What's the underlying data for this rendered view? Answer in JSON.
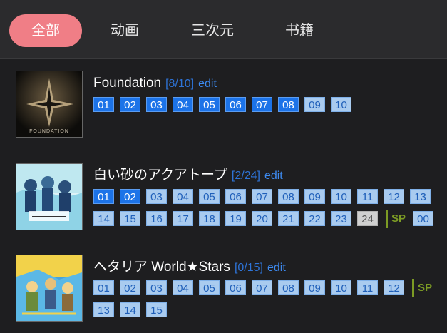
{
  "tabs": [
    "全部",
    "动画",
    "三次元",
    "书籍"
  ],
  "active_tab": 0,
  "items": [
    {
      "title": "Foundation",
      "progress": "[8/10]",
      "edit": "edit",
      "cover_text": "FOUNDATION",
      "episodes": [
        {
          "label": "01",
          "state": "watched"
        },
        {
          "label": "02",
          "state": "watched"
        },
        {
          "label": "03",
          "state": "watched"
        },
        {
          "label": "04",
          "state": "watched"
        },
        {
          "label": "05",
          "state": "watched"
        },
        {
          "label": "06",
          "state": "watched"
        },
        {
          "label": "07",
          "state": "watched"
        },
        {
          "label": "08",
          "state": "watched"
        },
        {
          "label": "09",
          "state": "unwatched"
        },
        {
          "label": "10",
          "state": "unwatched"
        }
      ]
    },
    {
      "title": "白い砂のアクアトープ",
      "progress": "[2/24]",
      "edit": "edit",
      "episodes": [
        {
          "label": "01",
          "state": "watched"
        },
        {
          "label": "02",
          "state": "watched"
        },
        {
          "label": "03",
          "state": "unwatched"
        },
        {
          "label": "04",
          "state": "unwatched"
        },
        {
          "label": "05",
          "state": "unwatched"
        },
        {
          "label": "06",
          "state": "unwatched"
        },
        {
          "label": "07",
          "state": "unwatched"
        },
        {
          "label": "08",
          "state": "unwatched"
        },
        {
          "label": "09",
          "state": "unwatched"
        },
        {
          "label": "10",
          "state": "unwatched"
        },
        {
          "label": "11",
          "state": "unwatched"
        },
        {
          "label": "12",
          "state": "unwatched"
        },
        {
          "label": "13",
          "state": "unwatched"
        },
        {
          "label": "14",
          "state": "unwatched"
        },
        {
          "label": "15",
          "state": "unwatched"
        },
        {
          "label": "16",
          "state": "unwatched"
        },
        {
          "label": "17",
          "state": "unwatched"
        },
        {
          "label": "18",
          "state": "unwatched"
        },
        {
          "label": "19",
          "state": "unwatched"
        },
        {
          "label": "20",
          "state": "unwatched"
        },
        {
          "label": "21",
          "state": "unwatched"
        },
        {
          "label": "22",
          "state": "unwatched"
        },
        {
          "label": "23",
          "state": "unwatched"
        },
        {
          "label": "24",
          "state": "na"
        }
      ],
      "sp_label": "SP",
      "sp_episodes": [
        {
          "label": "00",
          "state": "unwatched"
        }
      ]
    },
    {
      "title": "ヘタリア World★Stars",
      "progress": "[0/15]",
      "edit": "edit",
      "episodes": [
        {
          "label": "01",
          "state": "unwatched"
        },
        {
          "label": "02",
          "state": "unwatched"
        },
        {
          "label": "03",
          "state": "unwatched"
        },
        {
          "label": "04",
          "state": "unwatched"
        },
        {
          "label": "05",
          "state": "unwatched"
        },
        {
          "label": "06",
          "state": "unwatched"
        },
        {
          "label": "07",
          "state": "unwatched"
        },
        {
          "label": "08",
          "state": "unwatched"
        },
        {
          "label": "09",
          "state": "unwatched"
        },
        {
          "label": "10",
          "state": "unwatched"
        },
        {
          "label": "11",
          "state": "unwatched"
        },
        {
          "label": "12",
          "state": "unwatched"
        },
        {
          "label": "13",
          "state": "unwatched"
        },
        {
          "label": "14",
          "state": "unwatched"
        },
        {
          "label": "15",
          "state": "unwatched"
        }
      ],
      "sp_label": "SP",
      "sp_episodes": []
    }
  ],
  "colors": {
    "accent": "#f07e86",
    "watched": "#1c73e8",
    "unwatched": "#a9cbef",
    "sp": "#7c9b24",
    "link": "#3d8af0"
  }
}
